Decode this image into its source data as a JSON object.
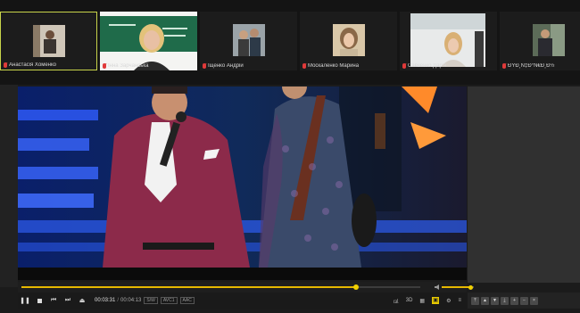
{
  "participants": [
    {
      "name": "Анастасія Хоменко",
      "active": true
    },
    {
      "name": "Інна Зарчанська",
      "active": false
    },
    {
      "name": "Іщенко Андрій",
      "active": false
    },
    {
      "name": "Москаленко Марина",
      "active": false
    },
    {
      "name": "Савченко Дар'я",
      "active": false
    },
    {
      "name": "ÐŸÐ¸Ñ‡Ð°Ñ€Ð¸Ð½",
      "active": false
    }
  ],
  "player": {
    "current_time": "00:03:31",
    "separator": "/",
    "duration": "00:04:13",
    "chips": [
      "S/W",
      "AVC1",
      "AAC"
    ],
    "progress_fraction": 0.84,
    "volume_fraction": 0.9,
    "tools": [
      "3D",
      "⚙",
      "≡"
    ]
  },
  "colors": {
    "accent": "#e6b800",
    "active_border": "#c8d44a",
    "mic_muted": "#e03a3a"
  }
}
